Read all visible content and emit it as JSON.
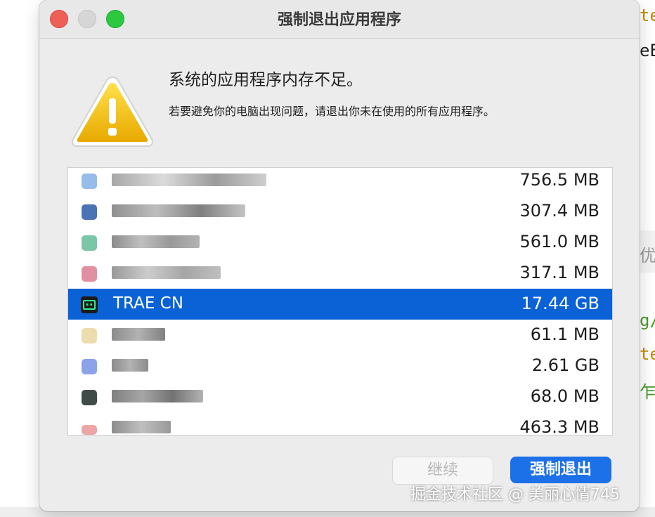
{
  "window": {
    "title": "强制退出应用程序"
  },
  "alert": {
    "headline": "系统的应用程序内存不足。",
    "message": "若要避免你的电脑出现问题，请退出你未在使用的所有应用程序。"
  },
  "apps": [
    {
      "name": "",
      "memory": "756.5 MB",
      "icon": "blurred-app-icon",
      "selected": false
    },
    {
      "name": "",
      "memory": "307.4 MB",
      "icon": "blurred-app-icon",
      "selected": false
    },
    {
      "name": "",
      "memory": "561.0 MB",
      "icon": "blurred-app-icon",
      "selected": false
    },
    {
      "name": "",
      "memory": "317.1 MB",
      "icon": "blurred-app-icon",
      "selected": false
    },
    {
      "name": "TRAE CN",
      "memory": "17.44 GB",
      "icon": "trae-icon",
      "selected": true
    },
    {
      "name": "",
      "memory": "61.1 MB",
      "icon": "blurred-app-icon",
      "selected": false
    },
    {
      "name": "",
      "memory": "2.61 GB",
      "icon": "blurred-app-icon",
      "selected": false
    },
    {
      "name": "",
      "memory": "68.0 MB",
      "icon": "blurred-app-icon",
      "selected": false
    },
    {
      "name": "",
      "memory": "463.3 MB",
      "icon": "blurred-app-icon",
      "selected": false
    }
  ],
  "buttons": {
    "continue": "继续",
    "force_quit": "强制退出"
  },
  "watermark": "掘金技术社区 @ 美丽心情745",
  "colors": {
    "selection": "#0a62d6",
    "primary_button": "#1c70e8",
    "warning": "#f2c200"
  }
}
